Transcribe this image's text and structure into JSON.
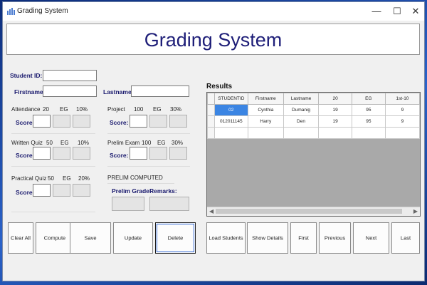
{
  "window": {
    "title": "Grading System",
    "controls": {
      "minimize": "—",
      "maximize": "☐",
      "close": "✕"
    }
  },
  "header": {
    "title": "Grading System"
  },
  "student": {
    "id_label": "Student ID:",
    "firstname_label": "Firstname:",
    "lastname_label": "Lastname:"
  },
  "criteria": {
    "attendance": {
      "label": "Attendance",
      "items": "20",
      "eg": "EG",
      "pct": "10%",
      "score_label": "Score:"
    },
    "project": {
      "label": "Project",
      "items": "100",
      "eg": "EG",
      "pct": "30%",
      "score_label": "Score:"
    },
    "written_quiz": {
      "label": "Written Quiz",
      "items": "50",
      "eg": "EG",
      "pct": "10%",
      "score_label": "Score:"
    },
    "prelim_exam": {
      "label": "Prelim Exam",
      "items": "100",
      "eg": "EG",
      "pct": "30%",
      "score_label": "Score:"
    },
    "practical_quiz": {
      "label": "Practical Quiz",
      "items": "50",
      "eg": "EG",
      "pct": "20%",
      "score_label": "Score:"
    }
  },
  "prelim": {
    "heading": "PRELIM COMPUTED",
    "grade_label": "Prelim Grade:",
    "remarks_label": "Remarks:"
  },
  "results": {
    "title": "Results",
    "columns": [
      "STUDENTID",
      "Firstname",
      "Lastname",
      "20",
      "EG",
      "1st-10"
    ],
    "rows": [
      [
        "02",
        "Cynthia",
        "Dumanig",
        "19",
        "95",
        "9"
      ],
      [
        "012011145",
        "Harry",
        "Den",
        "19",
        "95",
        "9"
      ]
    ]
  },
  "buttons": {
    "clear_all": "Clear All",
    "compute": "Compute",
    "save": "Save",
    "update": "Update",
    "delete": "Delete",
    "load_students": "Load Students",
    "show_details": "Show Details",
    "first": "First",
    "previous": "Previous",
    "next": "Next",
    "last": "Last"
  }
}
